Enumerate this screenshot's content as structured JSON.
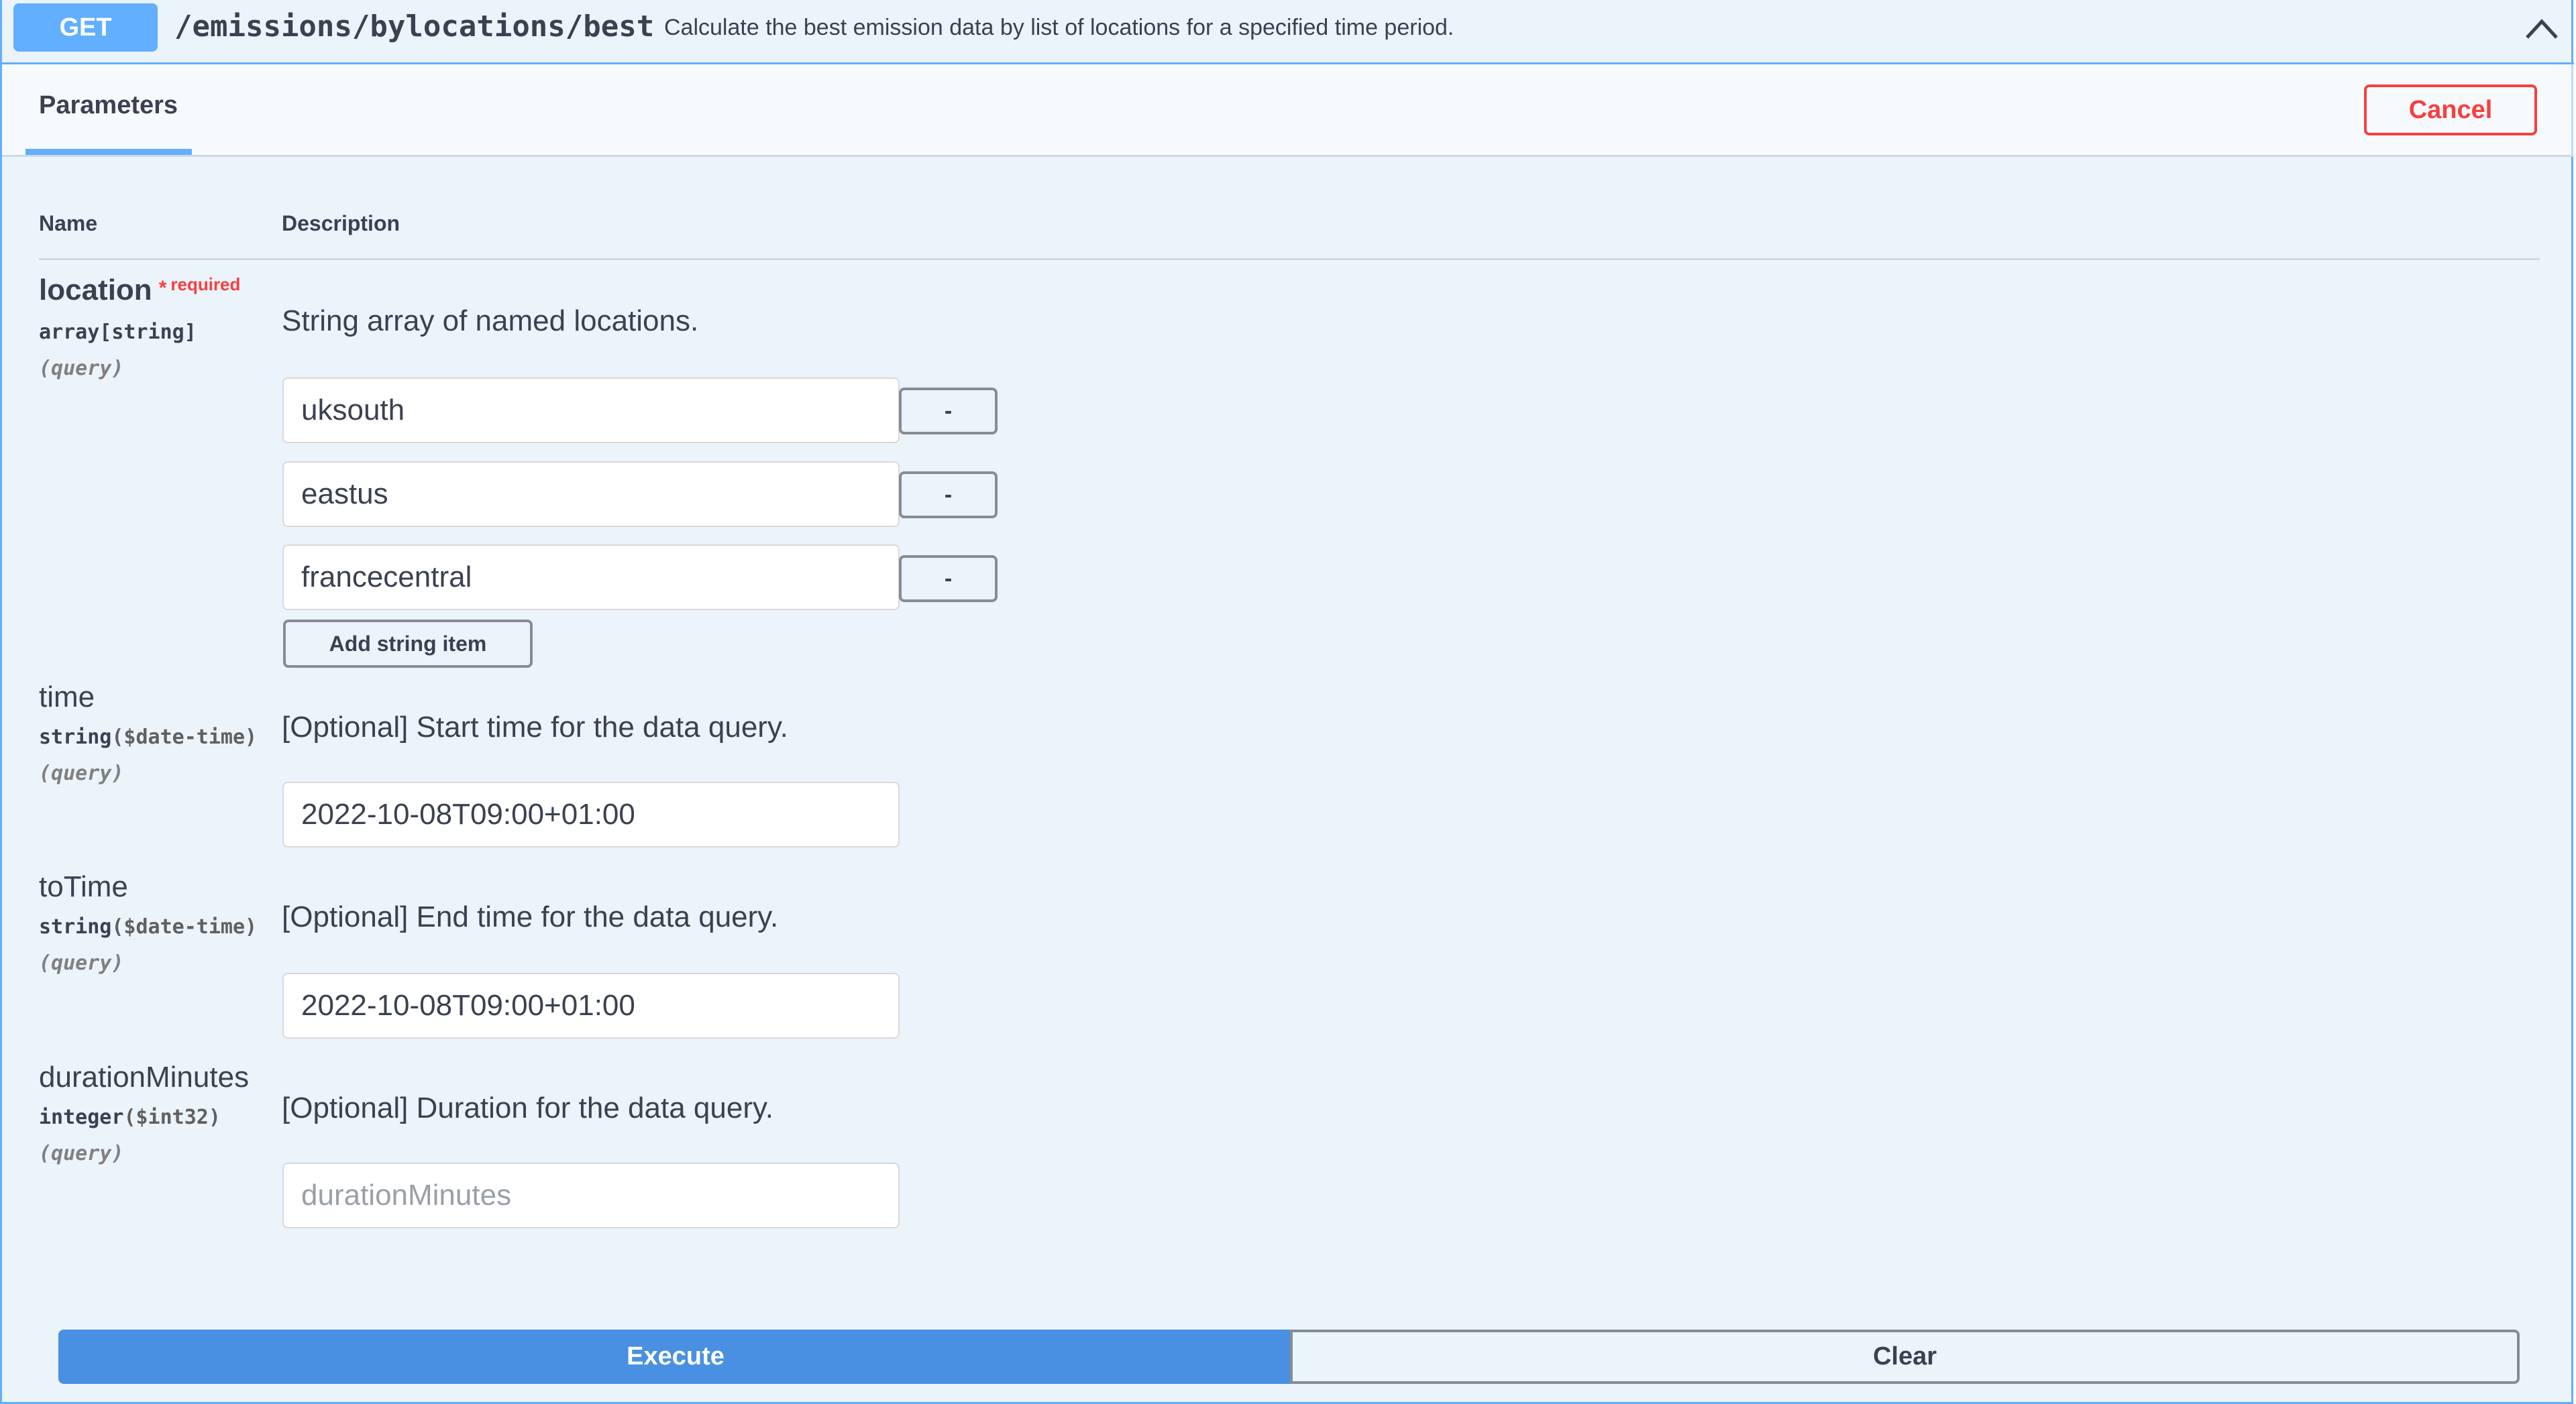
{
  "operation": {
    "method": "GET",
    "path": "/emissions/bylocations/best",
    "summary": "Calculate the best emission data by list of locations for a specified time period.",
    "collapse_icon": "chevron-up-icon"
  },
  "tabs": {
    "parameters_label": "Parameters",
    "cancel_label": "Cancel"
  },
  "table": {
    "name_header": "Name",
    "description_header": "Description"
  },
  "params": {
    "location": {
      "name": "location",
      "required_star": "*",
      "required_label": "required",
      "type": "array[string]",
      "format": "",
      "in": "(query)",
      "description": "String array of named locations.",
      "items": [
        "uksouth",
        "eastus",
        "francecentral"
      ],
      "remove_label": "-",
      "add_label": "Add string item"
    },
    "time": {
      "name": "time",
      "type": "string",
      "format": "($date-time)",
      "in": "(query)",
      "description": "[Optional] Start time for the data query.",
      "value": "2022-10-08T09:00+01:00"
    },
    "toTime": {
      "name": "toTime",
      "type": "string",
      "format": "($date-time)",
      "in": "(query)",
      "description": "[Optional] End time for the data query.",
      "value": "2022-10-08T09:00+01:00"
    },
    "durationMinutes": {
      "name": "durationMinutes",
      "type": "integer",
      "format": "($int32)",
      "in": "(query)",
      "description": "[Optional] Duration for the data query.",
      "value": "",
      "placeholder": "durationMinutes"
    }
  },
  "actions": {
    "execute_label": "Execute",
    "clear_label": "Clear"
  },
  "colors": {
    "get_blue": "#61affe",
    "execute_blue": "#4990e2",
    "danger_red": "#f93e3e",
    "block_bg": "#ebf3fb"
  }
}
